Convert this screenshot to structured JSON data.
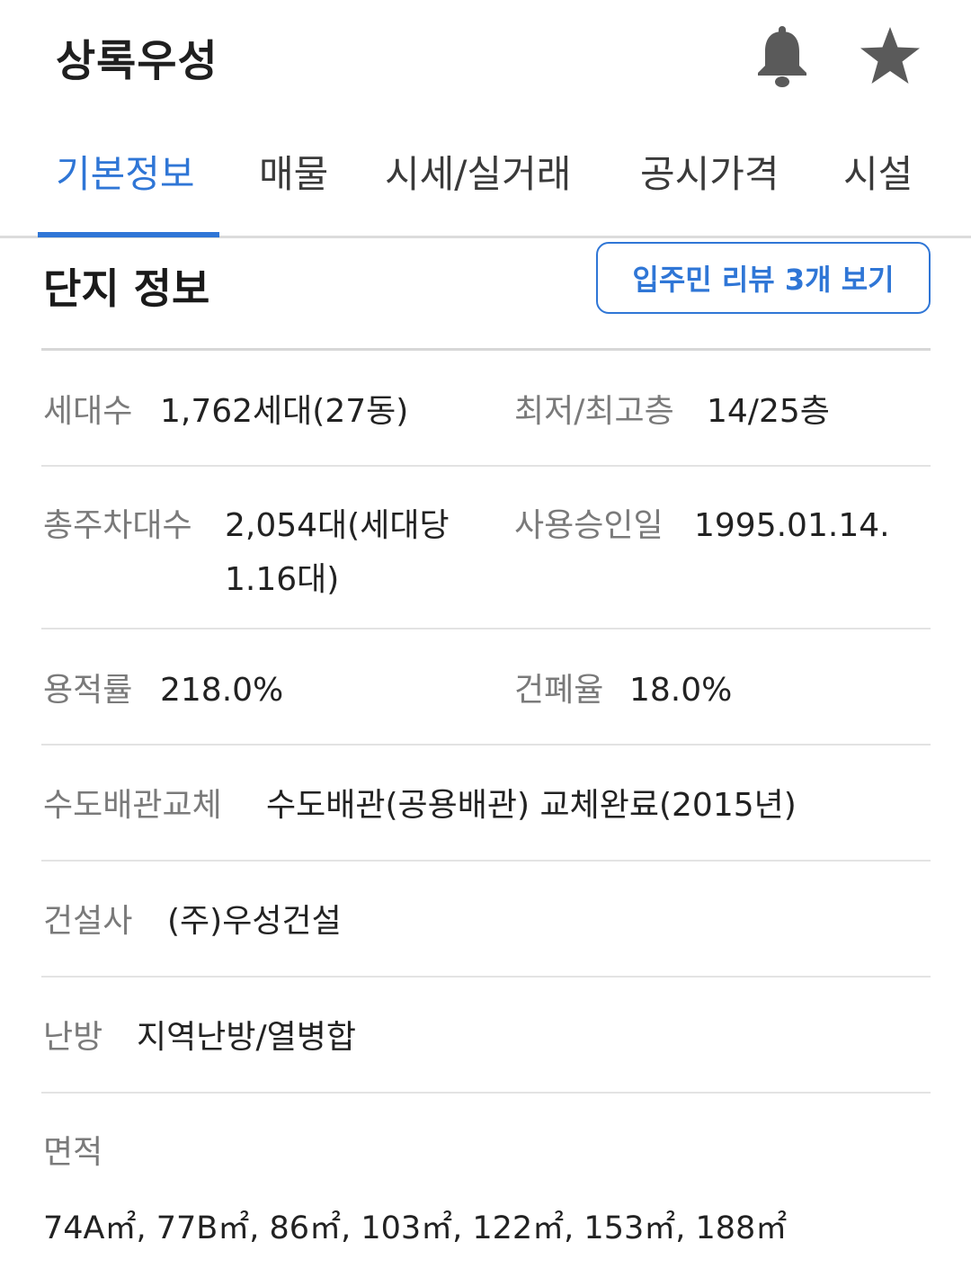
{
  "header": {
    "title": "상록우성",
    "bell_icon": "bell-icon",
    "star_icon": "star-icon",
    "icon_color": "#5a5a5a"
  },
  "tabs": [
    {
      "label": "기본정보",
      "active": true
    },
    {
      "label": "매물",
      "active": false
    },
    {
      "label": "시세/실거래",
      "active": false
    },
    {
      "label": "공시가격",
      "active": false
    },
    {
      "label": "시설",
      "active": false
    }
  ],
  "section": {
    "title": "단지 정보",
    "review_button": "입주민 리뷰 3개 보기"
  },
  "info": {
    "households_label": "세대수",
    "households_value": "1,762세대(27동)",
    "floors_label": "최저/최고층",
    "floors_value": "14/25층",
    "parking_label": "총주차대수",
    "parking_value_line1": "2,054대(세대당",
    "parking_value_line2": "1.16대)",
    "approval_label": "사용승인일",
    "approval_value": "1995.01.14.",
    "far_label": "용적률",
    "far_value": "218.0%",
    "bcr_label": "건폐율",
    "bcr_value": "18.0%",
    "pipe_label": "수도배관교체",
    "pipe_value": "수도배관(공용배관) 교체완료(2015년)",
    "builder_label": "건설사",
    "builder_value": "(주)우성건설",
    "heating_label": "난방",
    "heating_value": "지역난방/열병합",
    "area_label": "면적",
    "area_value": "74A㎡, 77B㎡, 86㎡, 103㎡, 122㎡, 153㎡, 188㎡"
  },
  "colors": {
    "accent": "#2f76d6",
    "label": "#7a7a7a",
    "value": "#222222"
  }
}
